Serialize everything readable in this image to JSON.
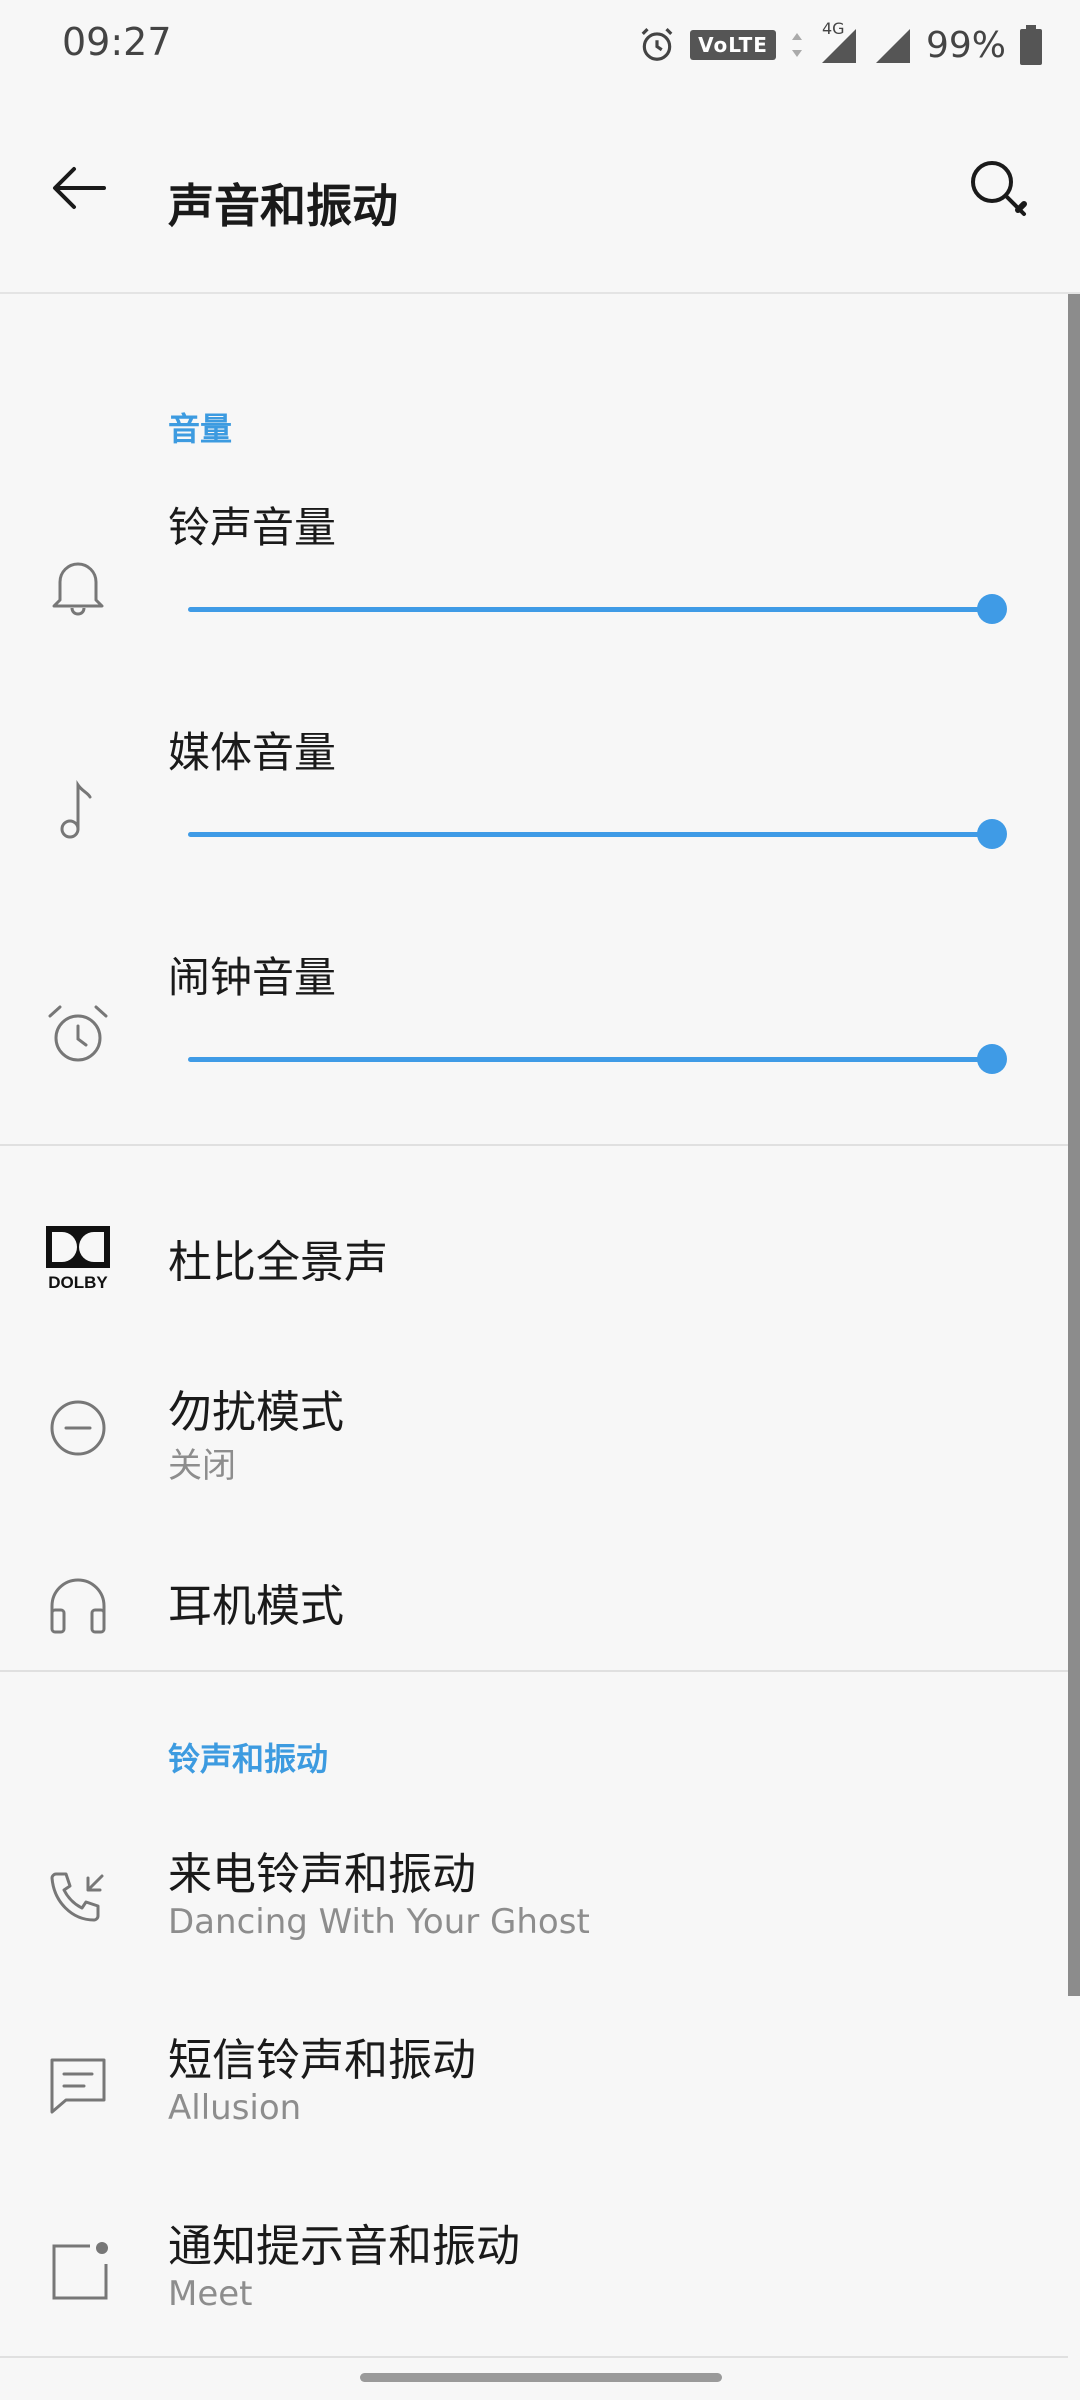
{
  "status_bar": {
    "time": "09:27",
    "volte": "VoLTE",
    "network": "4G",
    "battery": "99%",
    "icons": [
      "alarm-icon",
      "volte-icon",
      "data-arrows-icon",
      "signal-4g-icon",
      "signal-icon",
      "battery-icon"
    ]
  },
  "header": {
    "title": "声音和振动",
    "back_icon": "arrow-left-icon",
    "search_icon": "search-icon"
  },
  "volume_section": {
    "header": "音量",
    "sliders": [
      {
        "label": "铃声音量",
        "icon": "bell-icon",
        "value": 1.0
      },
      {
        "label": "媒体音量",
        "icon": "music-note-icon",
        "value": 1.0
      },
      {
        "label": "闹钟音量",
        "icon": "alarm-clock-icon",
        "value": 1.0
      }
    ]
  },
  "misc_items": [
    {
      "title": "杜比全景声",
      "icon": "dolby-icon",
      "logo_text": "DOLBY"
    },
    {
      "title": "勿扰模式",
      "subtitle": "关闭",
      "icon": "do-not-disturb-icon"
    },
    {
      "title": "耳机模式",
      "icon": "headphones-icon"
    }
  ],
  "ringtone_section": {
    "header": "铃声和振动",
    "items": [
      {
        "title": "来电铃声和振动",
        "subtitle": "Dancing With Your Ghost",
        "icon": "incoming-call-icon"
      },
      {
        "title": "短信铃声和振动",
        "subtitle": "Allusion",
        "icon": "message-icon"
      },
      {
        "title": "通知提示音和振动",
        "subtitle": "Meet",
        "icon": "notification-icon"
      }
    ]
  },
  "colors": {
    "accent": "#3f9be6",
    "background": "#f7f7f7",
    "text_primary": "#1a1a1a",
    "text_secondary": "#8d8d8d"
  }
}
